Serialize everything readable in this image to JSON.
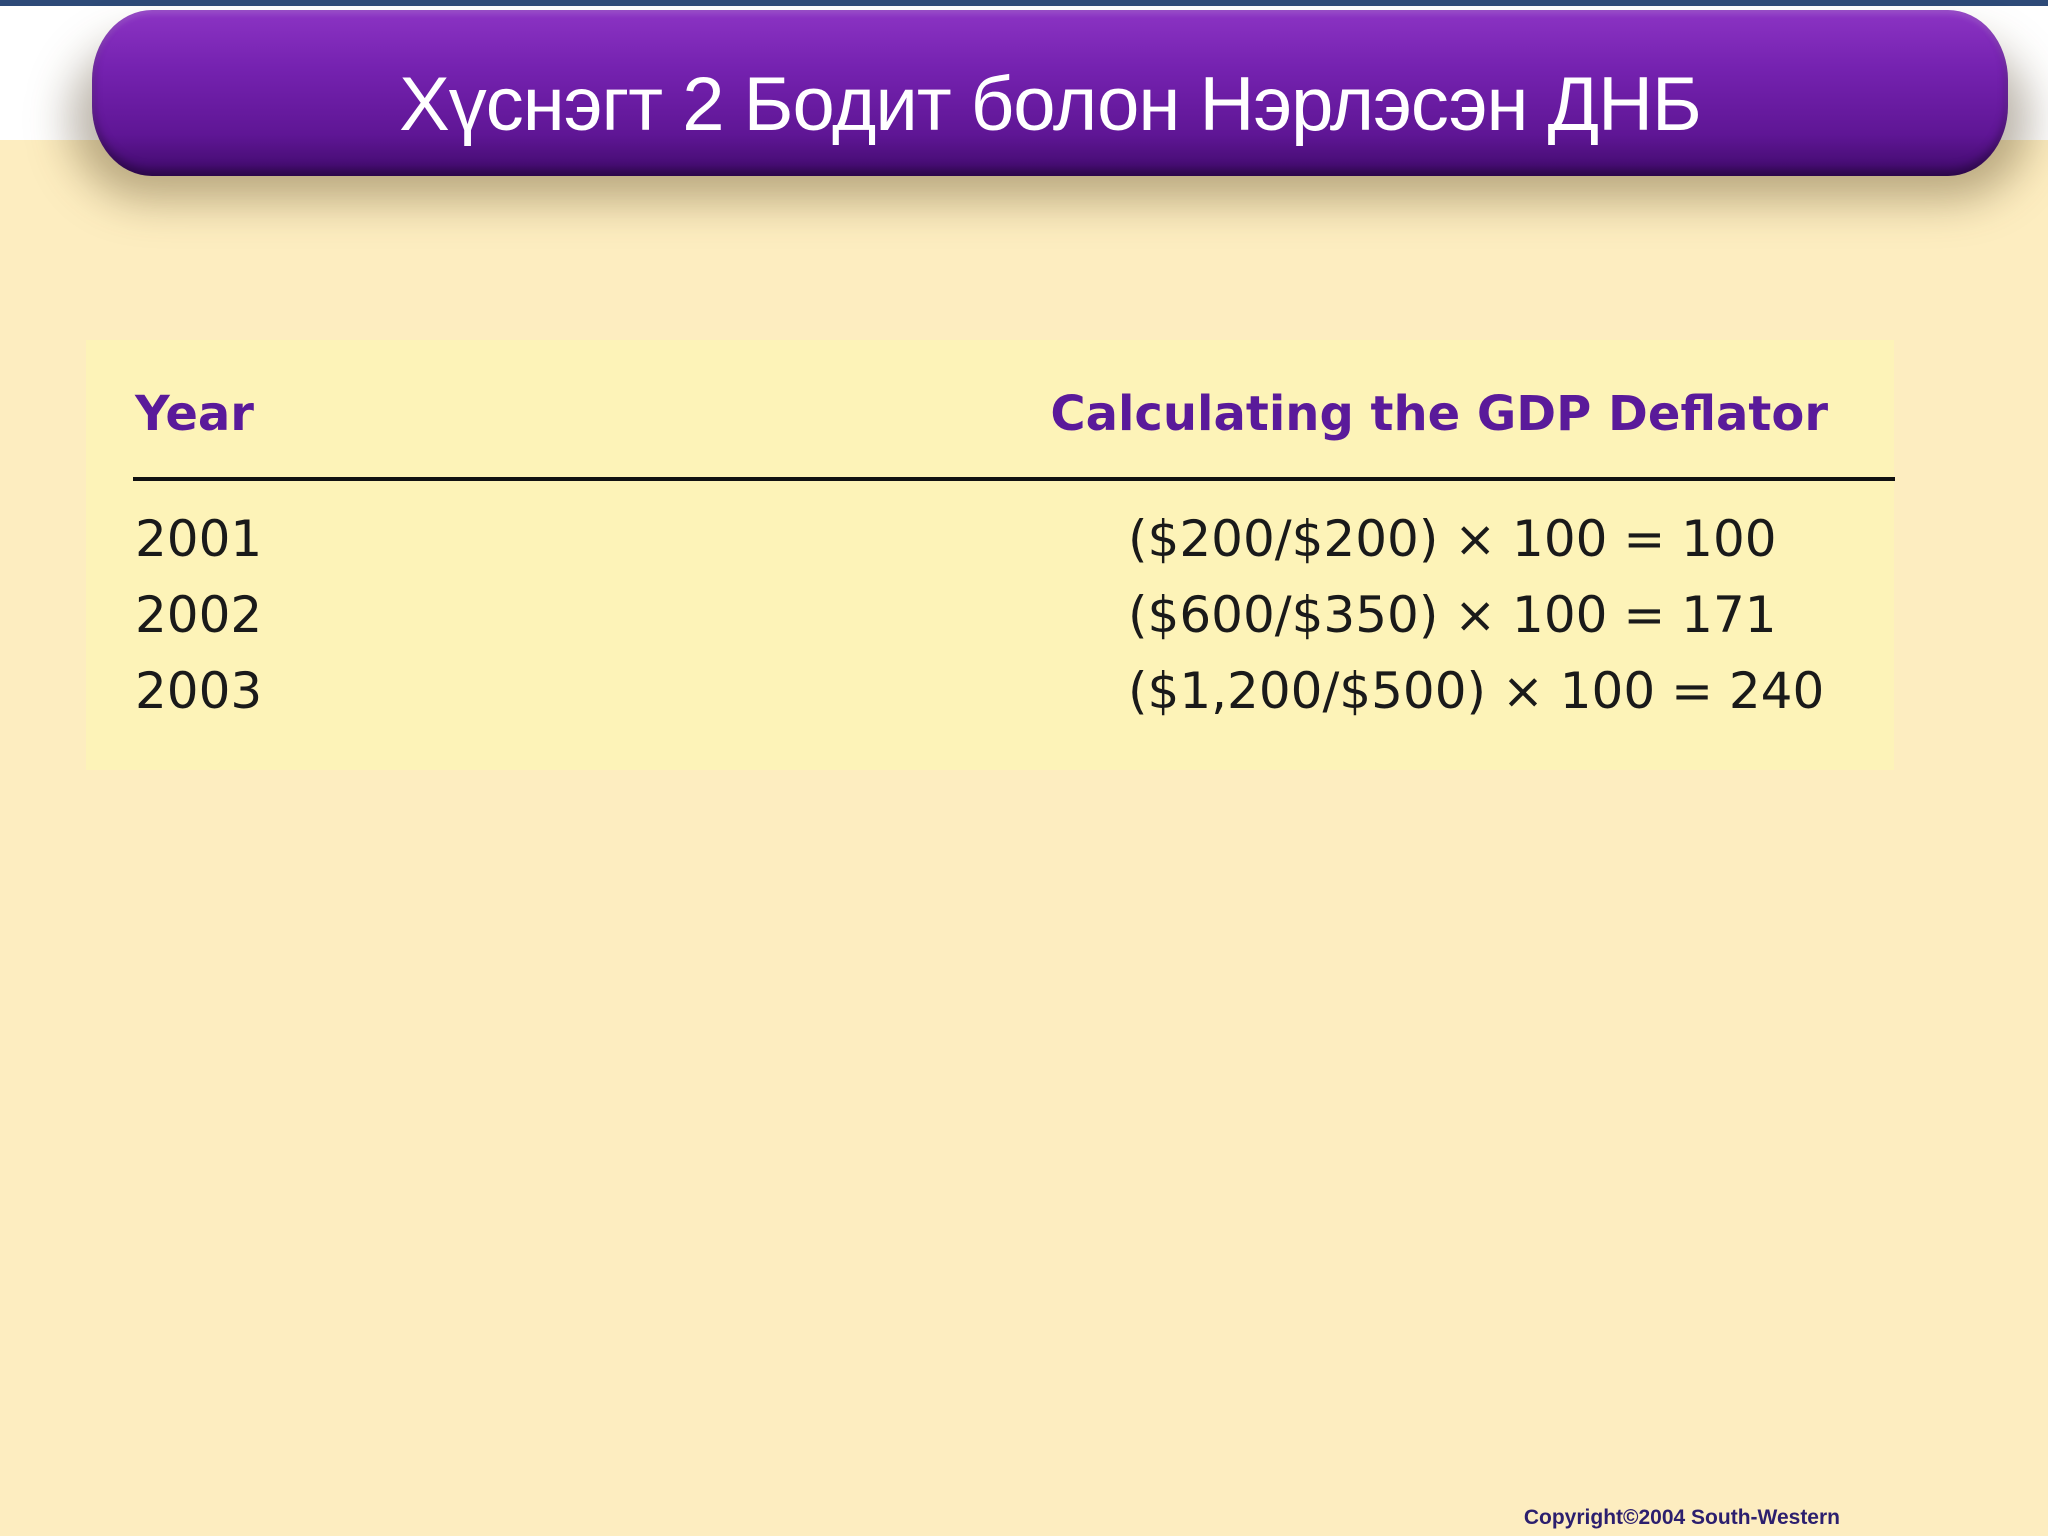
{
  "slide": {
    "title": "Хүснэгт 2 Бодит болон Нэрлэсэн ДНБ"
  },
  "table": {
    "headers": {
      "year": "Year",
      "calculation": "Calculating the GDP Deflator"
    },
    "rows": [
      {
        "year": "2001",
        "formula": "($200/$200) × 100 = 100"
      },
      {
        "year": "2002",
        "formula": "($600/$350) × 100 = 171"
      },
      {
        "year": "2003",
        "formula": "($1,200/$500) × 100 = 240"
      }
    ]
  },
  "footer": {
    "copyright": "Copyright©2004  South-Western"
  },
  "colors": {
    "title_bar": "#7522b0",
    "header_text": "#5a1a9a",
    "background": "#fdedc0",
    "table_panel": "#fdf3b8"
  }
}
